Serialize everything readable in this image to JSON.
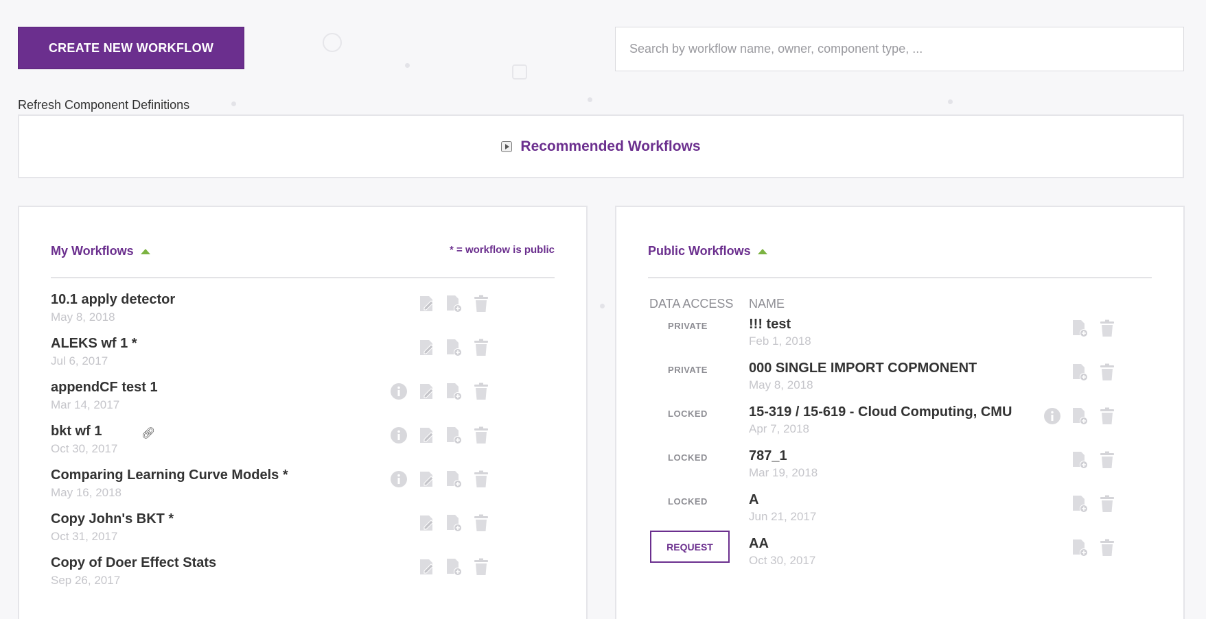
{
  "toolbar": {
    "create_label": "CREATE NEW WORKFLOW",
    "search_placeholder": "Search by workflow name, owner, component type, ...",
    "refresh_label": "Refresh Component Definitions"
  },
  "recommended": {
    "title": "Recommended Workflows"
  },
  "my_workflows": {
    "title": "My Workflows",
    "public_note": "* = workflow is public",
    "items": [
      {
        "name": "10.1 apply detector",
        "date": "May 8, 2018"
      },
      {
        "name": "ALEKS wf 1 *",
        "date": "Jul 6, 2017"
      },
      {
        "name": "appendCF test 1",
        "date": "Mar 14, 2017"
      },
      {
        "name": "bkt wf 1",
        "date": "Oct 30, 2017"
      },
      {
        "name": "Comparing Learning Curve Models *",
        "date": "May 16, 2018"
      },
      {
        "name": "Copy John's BKT *",
        "date": "Oct 31, 2017"
      },
      {
        "name": "Copy of Doer Effect Stats",
        "date": "Sep 26, 2017"
      }
    ]
  },
  "public_workflows": {
    "title": "Public Workflows",
    "col_access": "DATA ACCESS",
    "col_name": "NAME",
    "items": [
      {
        "access": "PRIVATE",
        "name": "!!! test",
        "date": "Feb 1, 2018"
      },
      {
        "access": "PRIVATE",
        "name": "000 SINGLE IMPORT COPMONENT",
        "date": "May 8, 2018"
      },
      {
        "access": "LOCKED",
        "name": "15-319 / 15-619 - Cloud Computing, CMU",
        "date": "Apr 7, 2018"
      },
      {
        "access": "LOCKED",
        "name": "787_1",
        "date": "Mar 19, 2018"
      },
      {
        "access": "LOCKED",
        "name": "A",
        "date": "Jun 21, 2017"
      },
      {
        "access": "REQUEST",
        "name": "AA",
        "date": "Oct 30, 2017"
      }
    ]
  },
  "colors": {
    "brand": "#6b2f8e",
    "accent_green": "#7cb342",
    "muted": "#c5c5ca"
  }
}
